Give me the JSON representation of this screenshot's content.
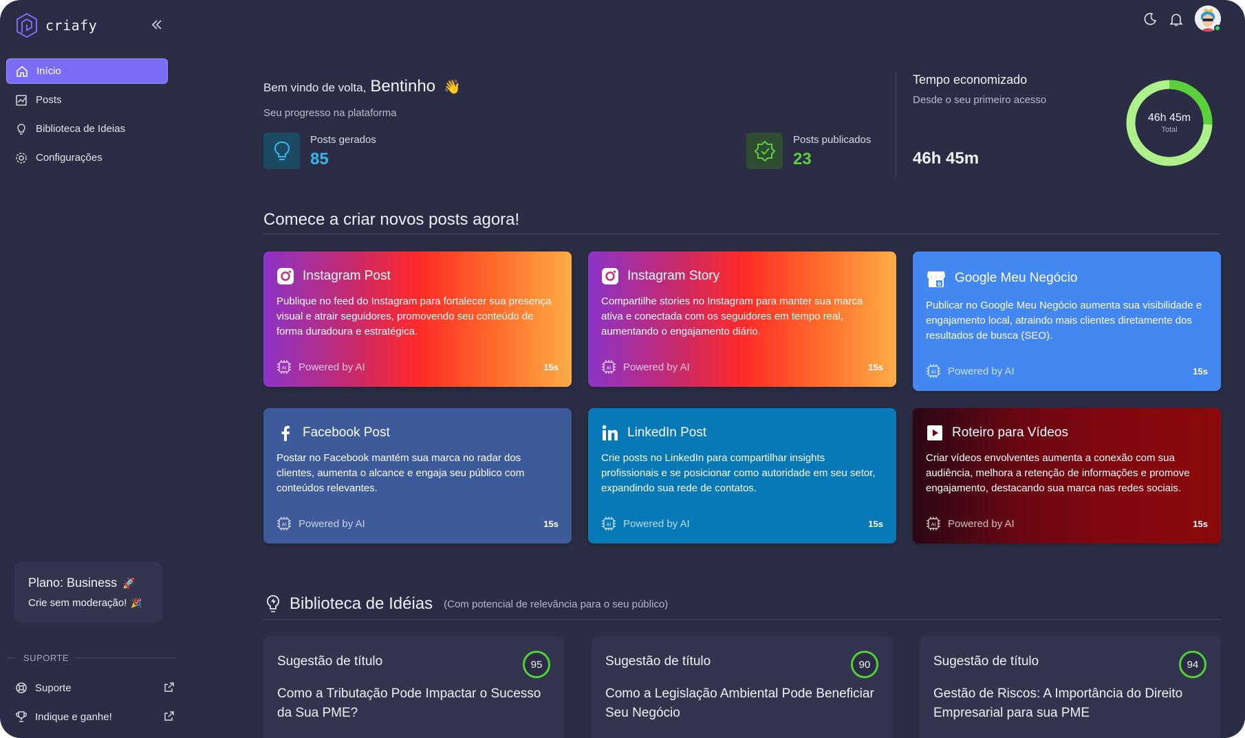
{
  "brand": {
    "name": "criafy",
    "logo_icon": "cube-logo-icon"
  },
  "sidebar": {
    "nav": [
      {
        "label": "Início",
        "icon": "home-icon",
        "active": true
      },
      {
        "label": "Posts",
        "icon": "chart-icon"
      },
      {
        "label": "Biblioteca de Ideias",
        "icon": "lightbulb-icon"
      },
      {
        "label": "Configurações",
        "icon": "gear-icon"
      }
    ],
    "plan": {
      "title": "Plano: Business",
      "subtitle": "Crie sem moderação!"
    },
    "support_heading": "SUPORTE",
    "support": [
      {
        "label": "Suporte",
        "icon": "lifebuoy-icon"
      },
      {
        "label": "Indique e ganhe!",
        "icon": "trophy-icon"
      }
    ]
  },
  "header": {
    "welcome_prefix": "Bem vindo de volta,",
    "user_name": "Bentinho",
    "progress_subtitle": "Seu progresso na plataforma"
  },
  "stats": {
    "generated": {
      "label": "Posts gerados",
      "value": "85",
      "color": "#38b6f0"
    },
    "published": {
      "label": "Posts publicados",
      "value": "23",
      "color": "#5ad13a"
    }
  },
  "time_saved": {
    "title": "Tempo economizado",
    "subtitle": "Desde o seu primeiro acesso",
    "value": "46h 45m",
    "donut_value": "46h 45m",
    "donut_label": "Total",
    "ring_colors": [
      "#5ad13a",
      "#aef08a"
    ]
  },
  "create_section": {
    "title": "Comece a criar novos posts agora!"
  },
  "cards": [
    {
      "title": "Instagram Post",
      "icon": "instagram-icon",
      "desc": "Publique no feed do Instagram para fortalecer sua presença visual e atrair seguidores, promovendo seu conteúdo de forma duradoura e estratégica.",
      "powered": "Powered by AI",
      "time": "15s"
    },
    {
      "title": "Instagram Story",
      "icon": "instagram-icon",
      "desc": "Compartilhe stories no Instagram para manter sua marca ativa e conectada com os seguidores em tempo real, aumentando o engajamento diário.",
      "powered": "Powered by AI",
      "time": "15s"
    },
    {
      "title": "Google Meu Negócio",
      "icon": "google-business-icon",
      "desc": "Publicar no Google Meu Negócio aumenta sua visibilidade e engajamento local, atraindo mais clientes diretamente dos resultados de busca (SEO).",
      "powered": "Powered by AI",
      "time": "15s"
    },
    {
      "title": "Facebook Post",
      "icon": "facebook-icon",
      "desc": "Postar no Facebook mantém sua marca no radar dos clientes, aumenta o alcance e engaja seu público com conteúdos relevantes.",
      "powered": "Powered by AI",
      "time": "15s"
    },
    {
      "title": "LinkedIn Post",
      "icon": "linkedin-icon",
      "desc": "Crie posts no LinkedIn para compartilhar insights profissionais e se posicionar como autoridade em seu setor, expandindo sua rede de contatos.",
      "powered": "Powered by AI",
      "time": "15s"
    },
    {
      "title": "Roteiro para Vídeos",
      "icon": "play-icon",
      "desc": "Criar vídeos envolventes aumenta a conexão com sua audiência, melhora a retenção de informações e promove engajamento, destacando sua marca nas redes sociais.",
      "powered": "Powered by AI",
      "time": "15s"
    }
  ],
  "library": {
    "title": "Biblioteca de Idéias",
    "subtitle": "(Com potencial de relevância para o seu público)",
    "ideas": [
      {
        "label": "Sugestão de título",
        "score": "95",
        "text": "Como a Tributação Pode Impactar o Sucesso da Sua PME?"
      },
      {
        "label": "Sugestão de título",
        "score": "90",
        "text": "Como a Legislação Ambiental Pode Beneficiar Seu Negócio"
      },
      {
        "label": "Sugestão de título",
        "score": "94",
        "text": "Gestão de Riscos: A Importância do Direito Empresarial para sua PME"
      }
    ]
  }
}
